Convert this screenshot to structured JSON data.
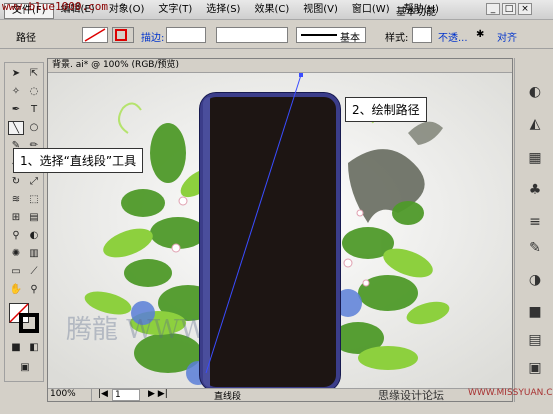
{
  "site_watermark_top": "www.blue1000.com",
  "menu": [
    "文件(F)",
    "编辑(E)",
    "对象(O)",
    "文字(T)",
    "选择(S)",
    "效果(C)",
    "视图(V)",
    "窗口(W)",
    "帮助(H)"
  ],
  "workspace": "基本功能",
  "control_bar": {
    "mode_label": "路径",
    "stroke_label": "描边:",
    "basic_label": "基本",
    "style_label": "样式:",
    "opacity_label": "不透...",
    "align_label": "对齐"
  },
  "document_tab": "背景. ai* @ 100% (RGB/预览)",
  "callouts": {
    "step1": "1、选择“直线段”工具",
    "step2": "2、绘制路径"
  },
  "status": {
    "zoom": "100%",
    "page": "1",
    "tool": "直线段"
  },
  "watermark_canvas": "腾龍 WWW.LLT.NET",
  "forum_text": "思缘设计论坛",
  "forum_url": "WWW.MISSYUAN.COM",
  "colors": {
    "phone_body": "#1d1513",
    "phone_border": "#3b3d8a",
    "path_line": "#3a4cff"
  }
}
